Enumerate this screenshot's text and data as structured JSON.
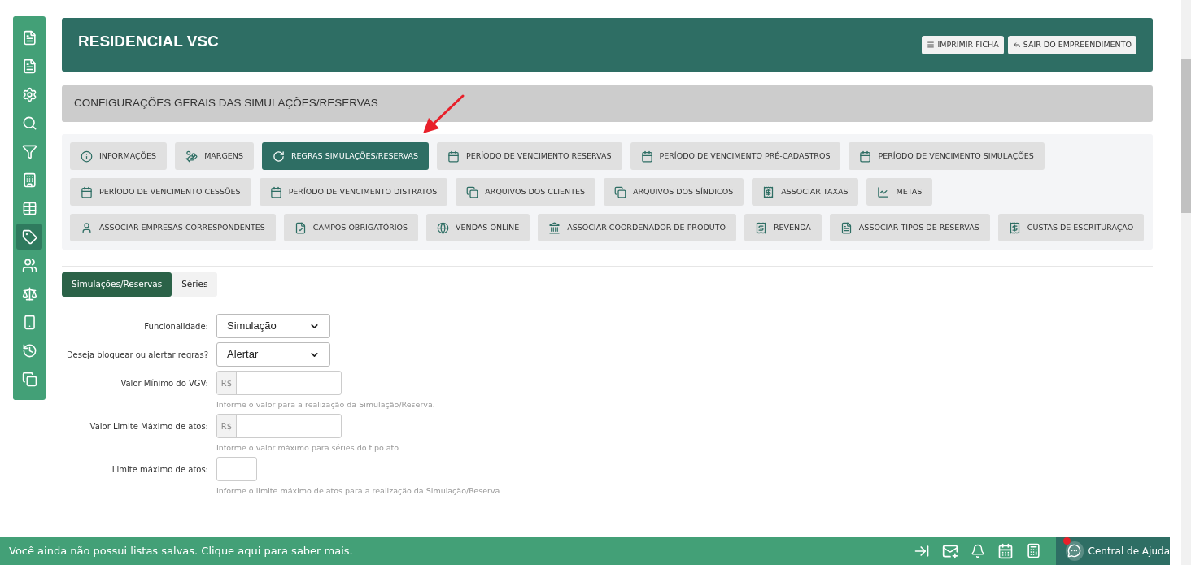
{
  "sidebar": {
    "items": [
      {
        "selected": false
      },
      {
        "selected": false
      },
      {
        "selected": false
      },
      {
        "selected": false
      },
      {
        "selected": false
      },
      {
        "selected": false
      },
      {
        "selected": false
      },
      {
        "selected": true
      },
      {
        "selected": false
      },
      {
        "selected": false
      },
      {
        "selected": false
      },
      {
        "selected": false
      },
      {
        "selected": false
      }
    ]
  },
  "header": {
    "title": "RESIDENCIAL VSC",
    "buttons": [
      "IMPRIMIR FICHA",
      "SAIR DO EMPREENDIMENTO"
    ]
  },
  "section_title": "CONFIGURAÇÕES GERAIS DAS SIMULAÇÕES/RESERVAS",
  "menu_buttons": [
    {
      "label": "INFORMAÇÕES",
      "selected": false
    },
    {
      "label": "MARGENS",
      "selected": false
    },
    {
      "label": "REGRAS SIMULAÇÕES/RESERVAS",
      "selected": true
    },
    {
      "label": "PERÍODO DE VENCIMENTO RESERVAS",
      "selected": false
    },
    {
      "label": "PERÍODO DE VENCIMENTO PRÉ-CADASTROS",
      "selected": false
    },
    {
      "label": "PERÍODO DE VENCIMENTO SIMULAÇÕES",
      "selected": false
    },
    {
      "label": "PERÍODO DE VENCIMENTO CESSÕES",
      "selected": false
    },
    {
      "label": "PERÍODO DE VENCIMENTO DISTRATOS",
      "selected": false
    },
    {
      "label": "ARQUIVOS DOS CLIENTES",
      "selected": false
    },
    {
      "label": "ARQUIVOS DOS SÍNDICOS",
      "selected": false
    },
    {
      "label": "ASSOCIAR TAXAS",
      "selected": false
    },
    {
      "label": "METAS",
      "selected": false
    },
    {
      "label": "ASSOCIAR EMPRESAS CORRESPONDENTES",
      "selected": false
    },
    {
      "label": "CAMPOS OBRIGATÓRIOS",
      "selected": false
    },
    {
      "label": "VENDAS ONLINE",
      "selected": false
    },
    {
      "label": "ASSOCIAR COORDENADOR DE PRODUTO",
      "selected": false
    },
    {
      "label": "REVENDA",
      "selected": false
    },
    {
      "label": "ASSOCIAR TIPOS DE RESERVAS",
      "selected": false
    },
    {
      "label": "CUSTAS DE ESCRITURAÇÃO",
      "selected": false
    }
  ],
  "tabs": [
    {
      "label": "Simulações/Reservas",
      "selected": true
    },
    {
      "label": "Séries",
      "selected": false
    }
  ],
  "form": {
    "fields": [
      {
        "kind": "select",
        "label": "Funcionalidade:",
        "value": "Simulação"
      },
      {
        "kind": "select",
        "label": "Deseja bloquear ou alertar regras?",
        "value": "Alertar"
      },
      {
        "kind": "currency",
        "label": "Valor Mínimo do VGV:",
        "prefix": "R$",
        "help": "Informe o valor para a realização da Simulação/Reserva."
      },
      {
        "kind": "currency",
        "label": "Valor Limite Máximo de atos:",
        "prefix": "R$",
        "help": "Informe o valor máximo para séries do tipo ato."
      },
      {
        "kind": "number",
        "label": "Limite máximo de atos:",
        "help": "Informe o limite máximo de atos para a realização da Simulação/Reserva."
      }
    ]
  },
  "bottom_bar": {
    "message": "Você ainda não possui listas salvas. Clique aqui para saber mais.",
    "help_label": "Central de Ajuda",
    "help_notification": true
  }
}
